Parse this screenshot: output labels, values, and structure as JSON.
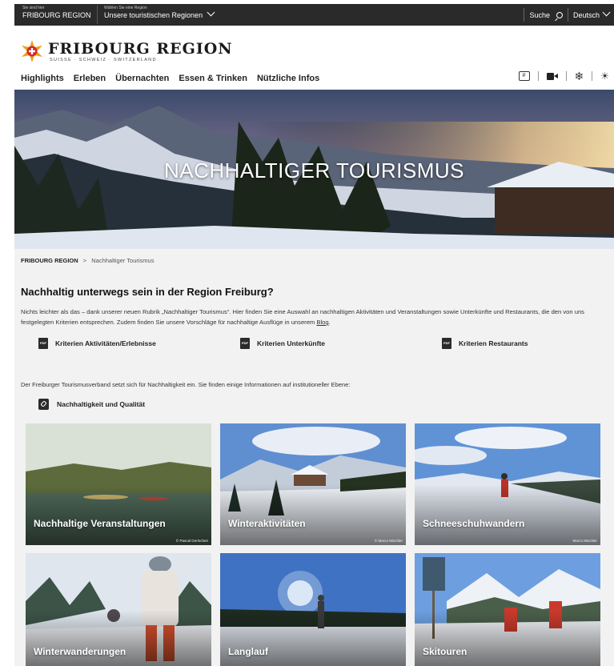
{
  "topbar": {
    "location_hint": "Sie sind hier",
    "location_value": "FRIBOURG REGION",
    "region_hint": "Wählen Sie eine Region",
    "region_value": "Unsere touristischen Regionen",
    "search_label": "Suche",
    "language_label": "Deutsch"
  },
  "logo": {
    "title": "FRIBOURG REGION",
    "subtitle": "SUISSE · SCHWEIZ · SWITZERLAND"
  },
  "nav": {
    "items": [
      {
        "label": "Highlights"
      },
      {
        "label": "Erleben"
      },
      {
        "label": "Übernachten"
      },
      {
        "label": "Essen & Trinken"
      },
      {
        "label": "Nützliche Infos"
      }
    ],
    "icons": [
      "hashtag-icon",
      "video-icon",
      "snowflake-icon",
      "sun-icon"
    ]
  },
  "hero": {
    "title": "NACHHALTIGER TOURISMUS"
  },
  "breadcrumb": {
    "root": "FRIBOURG REGION",
    "separator": ">",
    "current": "Nachhaltiger Tourismus"
  },
  "intro": {
    "title": "Nachhaltig unterwegs sein in der Region Freiburg?",
    "text_before_link": "Nichts leichter als das – dank unserer neuen Rubrik „Nachhaltiger Tourismus“. Hier finden Sie eine Auswahl an nachhaltigen Aktivitäten und Veranstaltungen sowie Unterkünfte und Restaurants, die den von uns festgelegten Kriterien entsprechen. Zudem finden Sie unsere Vorschläge für nachhaltige Ausflüge in unserem",
    "link_text": "Blog",
    "text_after_link": "."
  },
  "pdf_links": [
    {
      "icon_text": "PDF",
      "label": "Kriterien Aktivitäten/Erlebnisse"
    },
    {
      "icon_text": "PDF",
      "label": "Kriterien Unterkünfte"
    },
    {
      "icon_text": "PDF",
      "label": "Kriterien Restaurants"
    }
  ],
  "institutional": {
    "text": "Der Freiburger Tourismusverband setzt sich für Nachhaltigkeit ein. Sie finden einige Informationen auf institutioneller Ebene:",
    "link_label": "Nachhaltigkeit und Qualität"
  },
  "tiles": [
    {
      "label": "Nachhaltige Veranstaltungen",
      "credit": "© Pascal Gertschen"
    },
    {
      "label": "Winteraktivitäten",
      "credit": "© Marco Mischler"
    },
    {
      "label": "Schneeschuhwandern",
      "credit": "Marco Mischler"
    },
    {
      "label": "Winterwanderungen",
      "credit": ""
    },
    {
      "label": "Langlauf",
      "credit": ""
    },
    {
      "label": "Skitouren",
      "credit": ""
    }
  ],
  "colors": {
    "topbar_bg": "#2a2a2a",
    "content_bg": "#f2f2f2",
    "logo_star": "#e8a31c",
    "logo_cross_red": "#d62828"
  }
}
